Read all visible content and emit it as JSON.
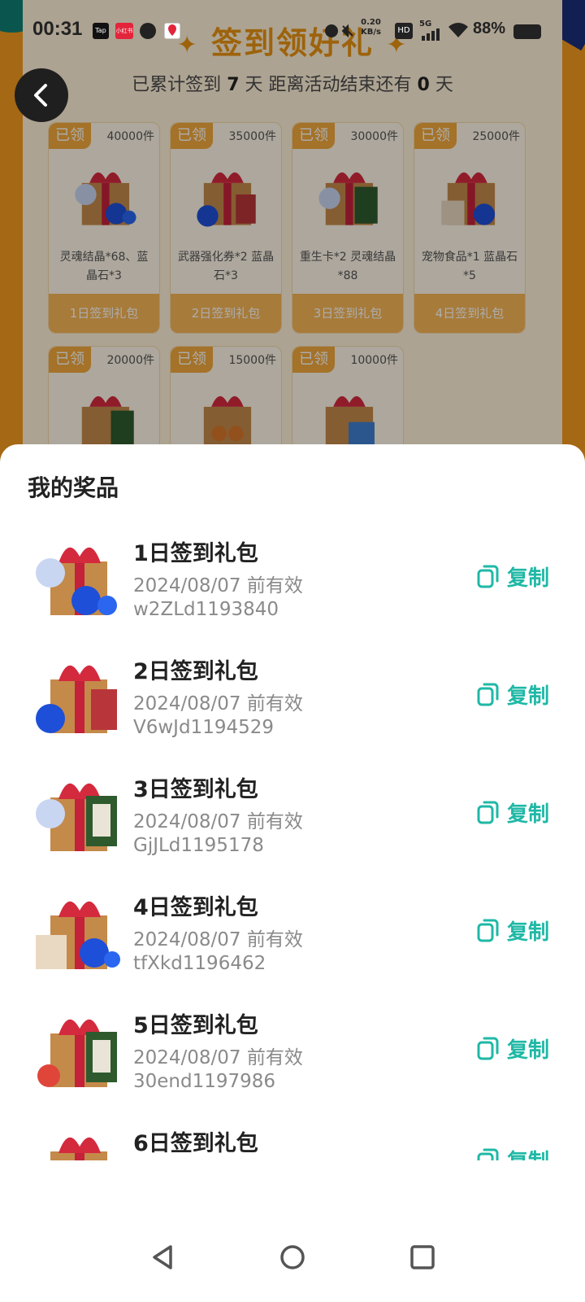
{
  "status_bar": {
    "time": "00:31",
    "app_badges": [
      "Tap",
      "小红书"
    ],
    "network_speed": "0.20",
    "network_unit": "KB/s",
    "hd": "HD",
    "signal": "5G",
    "battery": "88%"
  },
  "background": {
    "title": "签到领好礼",
    "subtitle_prefix": "已累计签到",
    "days_signed": "7",
    "subtitle_mid": "天 距离活动结束还有",
    "days_left": "0",
    "subtitle_suffix": "天",
    "gifts": [
      {
        "tag": "已领",
        "count": "40000件",
        "desc": "灵魂结晶*68、蓝晶石*3",
        "button": "1日签到礼包"
      },
      {
        "tag": "已领",
        "count": "35000件",
        "desc": "武器强化券*2 蓝晶石*3",
        "button": "2日签到礼包"
      },
      {
        "tag": "已领",
        "count": "30000件",
        "desc": "重生卡*2 灵魂结晶*88",
        "button": "3日签到礼包"
      },
      {
        "tag": "已领",
        "count": "25000件",
        "desc": "宠物食品*1 蓝晶石*5",
        "button": "4日签到礼包"
      },
      {
        "tag": "已领",
        "count": "20000件",
        "desc": "",
        "button": ""
      },
      {
        "tag": "已领",
        "count": "15000件",
        "desc": "",
        "button": ""
      },
      {
        "tag": "已领",
        "count": "10000件",
        "desc": "",
        "button": ""
      }
    ]
  },
  "sheet": {
    "title": "我的奖品",
    "copy_label": "复制",
    "prizes": [
      {
        "title": "1日签到礼包",
        "expiry": "2024/08/07 前有效",
        "code": "w2ZLd1193840"
      },
      {
        "title": "2日签到礼包",
        "expiry": "2024/08/07 前有效",
        "code": "V6wJd1194529"
      },
      {
        "title": "3日签到礼包",
        "expiry": "2024/08/07 前有效",
        "code": "GjJLd1195178"
      },
      {
        "title": "4日签到礼包",
        "expiry": "2024/08/07 前有效",
        "code": "tfXkd1196462"
      },
      {
        "title": "5日签到礼包",
        "expiry": "2024/08/07 前有效",
        "code": "30end1197986"
      },
      {
        "title": "6日签到礼包",
        "expiry": "",
        "code": ""
      }
    ]
  },
  "colors": {
    "accent": "#1FB8A6",
    "bg_orange": "#F39A1E",
    "tag_orange": "#F2A83B"
  }
}
